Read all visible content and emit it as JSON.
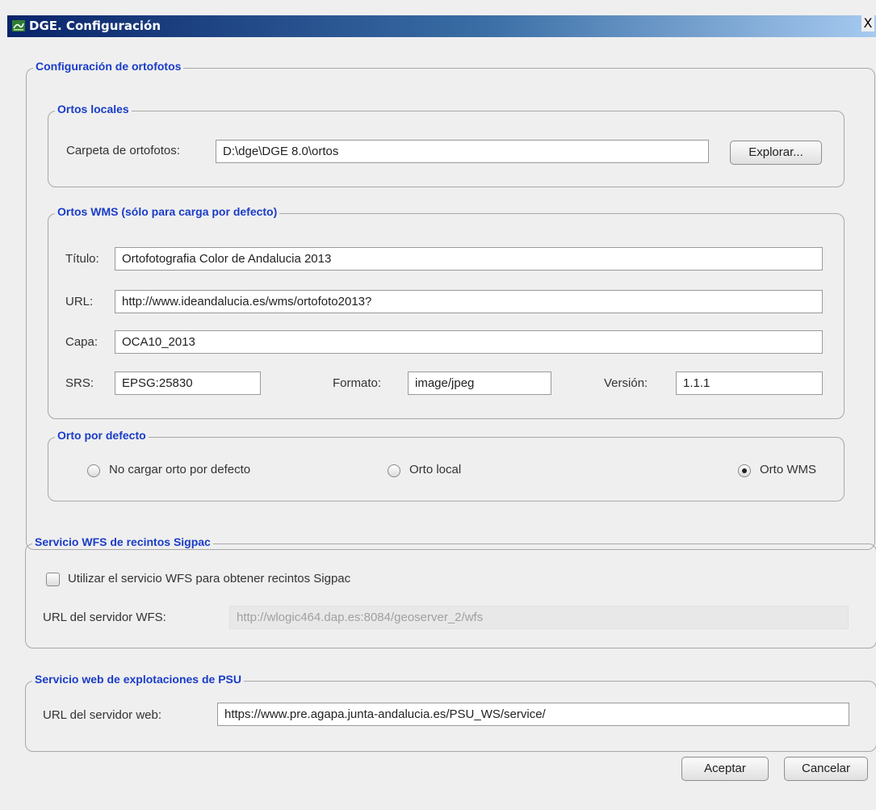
{
  "window": {
    "title": "DGE. Configuración",
    "close_label": "X"
  },
  "ortofotos": {
    "title": "Configuración de ortofotos",
    "locales": {
      "title": "Ortos locales",
      "folder_label": "Carpeta de ortofotos:",
      "folder_value": "D:\\dge\\DGE 8.0\\ortos",
      "browse_label": "Explorar..."
    },
    "wms": {
      "title": "Ortos WMS (sólo para carga por defecto)",
      "titulo_label": "Título:",
      "titulo_value": "Ortofotografia Color de Andalucia 2013",
      "url_label": "URL:",
      "url_value": "http://www.ideandalucia.es/wms/ortofoto2013?",
      "capa_label": "Capa:",
      "capa_value": "OCA10_2013",
      "srs_label": "SRS:",
      "srs_value": "EPSG:25830",
      "formato_label": "Formato:",
      "formato_value": "image/jpeg",
      "version_label": "Versión:",
      "version_value": "1.1.1"
    },
    "defecto": {
      "title": "Orto por defecto",
      "options": [
        {
          "label": "No cargar orto por defecto",
          "selected": false
        },
        {
          "label": "Orto local",
          "selected": false
        },
        {
          "label": "Orto WMS",
          "selected": true
        }
      ]
    }
  },
  "wfs": {
    "title": "Servicio WFS de recintos Sigpac",
    "checkbox_label": "Utilizar el servicio WFS para obtener recintos Sigpac",
    "checked": false,
    "url_label": "URL del servidor WFS:",
    "url_value": "http://wlogic464.dap.es:8084/geoserver_2/wfs"
  },
  "psu": {
    "title": "Servicio web de explotaciones de PSU",
    "url_label": "URL del servidor web:",
    "url_value": "https://www.pre.agapa.junta-andalucia.es/PSU_WS/service/"
  },
  "buttons": {
    "accept": "Aceptar",
    "cancel": "Cancelar"
  },
  "colors": {
    "legend": "#1a3cc8",
    "titlebar": "#0a246a"
  }
}
